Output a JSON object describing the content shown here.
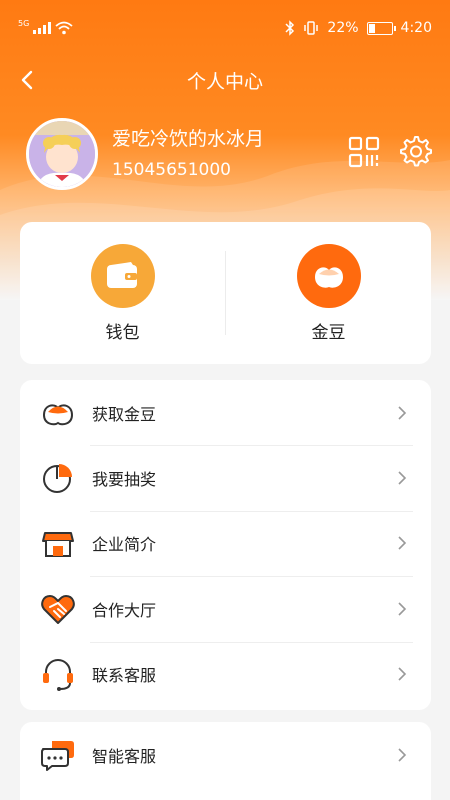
{
  "status_bar": {
    "network": "5G",
    "battery_percent": "22%",
    "time": "4:20"
  },
  "nav": {
    "title": "个人中心"
  },
  "profile": {
    "name": "爱吃冷饮的水冰月",
    "phone": "15045651000"
  },
  "quick": [
    {
      "label": "钱包",
      "icon": "wallet-icon",
      "color": "#f7a838"
    },
    {
      "label": "金豆",
      "icon": "bean-icon",
      "color": "#ff6a0e"
    }
  ],
  "menu": [
    {
      "label": "获取金豆",
      "icon": "bean-icon"
    },
    {
      "label": "我要抽奖",
      "icon": "pie-icon"
    },
    {
      "label": "企业简介",
      "icon": "shop-icon"
    },
    {
      "label": "合作大厅",
      "icon": "handshake-heart-icon"
    },
    {
      "label": "联系客服",
      "icon": "headset-icon"
    }
  ],
  "menu2": [
    {
      "label": "智能客服",
      "icon": "chat-bubbles-icon"
    }
  ],
  "colors": {
    "accent": "#ff7a12",
    "icon_orange": "#ff6a0e",
    "icon_outline": "#333333"
  }
}
